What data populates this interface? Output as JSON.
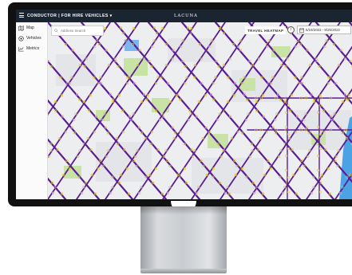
{
  "app": {
    "title": "CONDUCTOR | FOR HIRE VEHICLES ▾",
    "brand": "LACUNA"
  },
  "sidebar": {
    "items": [
      {
        "label": "Map",
        "icon": "map-icon"
      },
      {
        "label": "Vehicles",
        "icon": "vehicle-icon"
      },
      {
        "label": "Metrics",
        "icon": "metrics-icon"
      }
    ]
  },
  "search": {
    "placeholder": "Address Search"
  },
  "toolbar": {
    "heatmap_label": "TRAVEL HEATMAP",
    "info_label": "i",
    "date_range": "5/19/2022 - 9/25/2022"
  },
  "colors": {
    "topbar": "#1b2431",
    "route": "#5b1d96",
    "dot": "#e2c84a",
    "park": "#c8e3a5",
    "water": "#4ba3e6"
  }
}
